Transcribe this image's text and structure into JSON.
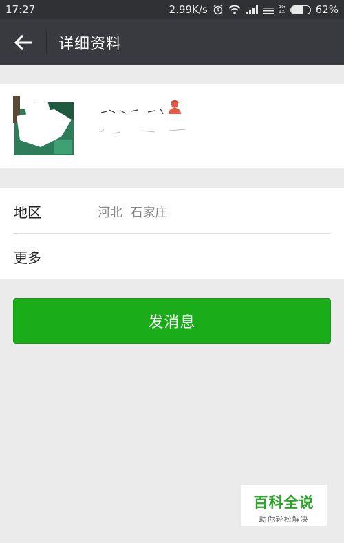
{
  "status_bar": {
    "time": "17:27",
    "speed": "2.99K/s",
    "network_top": "4G",
    "network_bottom": "1X",
    "battery": "62%",
    "battery_level": 0.62
  },
  "header": {
    "title": "详细资料"
  },
  "profile": {
    "name": "",
    "gender_icon": "female-user-icon"
  },
  "info": {
    "region_label": "地区",
    "region_value": "河北  石家庄",
    "more_label": "更多"
  },
  "actions": {
    "send_message": "发消息"
  },
  "watermark": {
    "title": "百科全说",
    "subtitle": "助你轻松解决"
  },
  "colors": {
    "accent": "#1aad19",
    "header": "#393a3f",
    "status_bar": "#303134"
  }
}
